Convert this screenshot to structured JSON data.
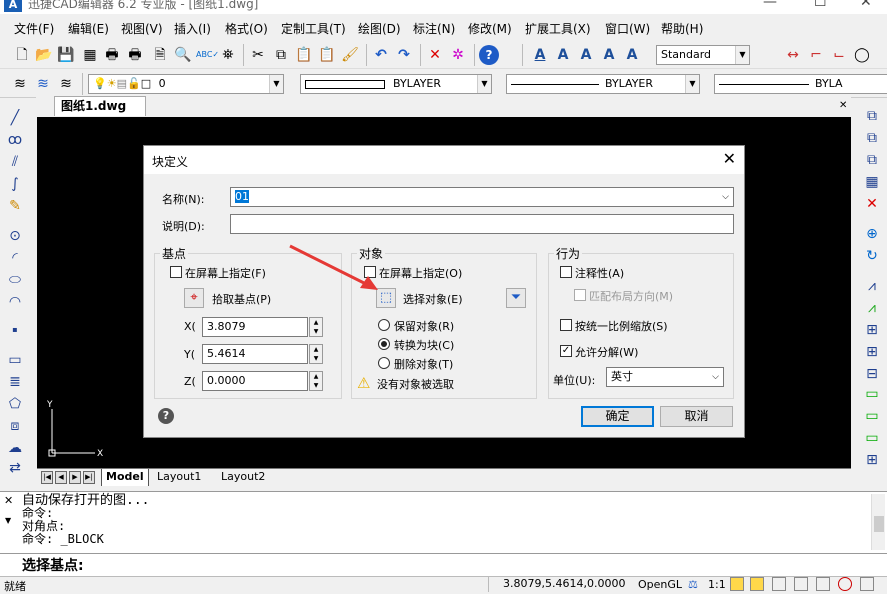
{
  "window": {
    "title": "迅捷CAD编辑器 6.2 专业版 - [图纸1.dwg]",
    "minimize": "—",
    "maximize": "☐",
    "close": "✕"
  },
  "menu": [
    "文件(F)",
    "编辑(E)",
    "视图(V)",
    "插入(I)",
    "格式(O)",
    "定制工具(T)",
    "绘图(D)",
    "标注(N)",
    "修改(M)",
    "扩展工具(X)",
    "窗口(W)",
    "帮助(H)"
  ],
  "toolbar": {
    "text_style": "Standard",
    "layer": "0",
    "linetype": "BYLAYER",
    "lineweight": "BYLAYER",
    "plotstyle": "BYLA"
  },
  "doc_tab": {
    "label": "图纸1.dwg",
    "close": "✕"
  },
  "layout_tabs": [
    "Model",
    "Layout1",
    "Layout2"
  ],
  "ucs": {
    "x": "X",
    "y": "Y"
  },
  "dialog": {
    "title": "块定义",
    "close": "✕",
    "name_label": "名称(N):",
    "name_value": "01",
    "desc_label": "说明(D):",
    "desc_value": "",
    "base": {
      "title": "基点",
      "specify": "在屏幕上指定(F)",
      "pick": "拾取基点(P)",
      "x_label": "X(",
      "x": "3.8079",
      "y_label": "Y(",
      "y": "5.4614",
      "z_label": "Z(",
      "z": "0.0000"
    },
    "objects": {
      "title": "对象",
      "specify": "在屏幕上指定(O)",
      "select": "选择对象(E)",
      "retain": "保留对象(R)",
      "convert": "转换为块(C)",
      "delete": "删除对象(T)",
      "warning": "没有对象被选取"
    },
    "behavior": {
      "title": "行为",
      "annotative": "注释性(A)",
      "match": "匹配布局方向(M)",
      "uniform": "按统一比例缩放(S)",
      "explode": "允许分解(W)",
      "units_label": "单位(U):",
      "units_value": "英寸"
    },
    "ok": "确定",
    "cancel": "取消"
  },
  "command_lines": [
    "自动保存打开的图...",
    "命令:",
    "对角点:",
    "命令: _BLOCK"
  ],
  "prompt": "选择基点:",
  "status": {
    "state": "就绪",
    "coords": "3.8079,5.4614,0.0000",
    "renderer": "OpenGL",
    "scale": "1:1"
  },
  "colors": {
    "accent": "#0078d7",
    "canvas": "#000000",
    "arrow": "#e53935"
  }
}
